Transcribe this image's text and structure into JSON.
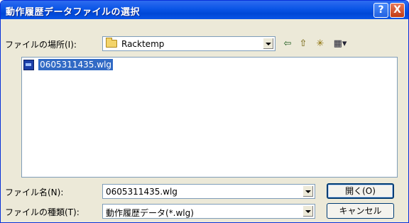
{
  "dialog": {
    "title": "動作履歴データファイルの選択",
    "help_symbol": "?",
    "close_symbol": "X"
  },
  "toolbar": {
    "lookin_label": "ファイルの場所(I):",
    "lookin_value": "Racktemp",
    "back_glyph": "⇦",
    "up_glyph": "⇧",
    "newfolder_glyph": "✳",
    "view_glyph": "▦▾"
  },
  "files": [
    {
      "name": "0605311435.wlg",
      "icon": "wlg-file-icon",
      "selected": true
    }
  ],
  "form": {
    "filename_label": "ファイル名(N):",
    "filename_value": "0605311435.wlg",
    "filetype_label": "ファイルの種類(T):",
    "filetype_value": "動作履歴データ(*.wlg)"
  },
  "buttons": {
    "open": "開く(O)",
    "cancel": "キャンセル"
  },
  "colors": {
    "titlebar": "#0a55e6",
    "selection": "#316ac5",
    "window_bg": "#ece9d8"
  }
}
